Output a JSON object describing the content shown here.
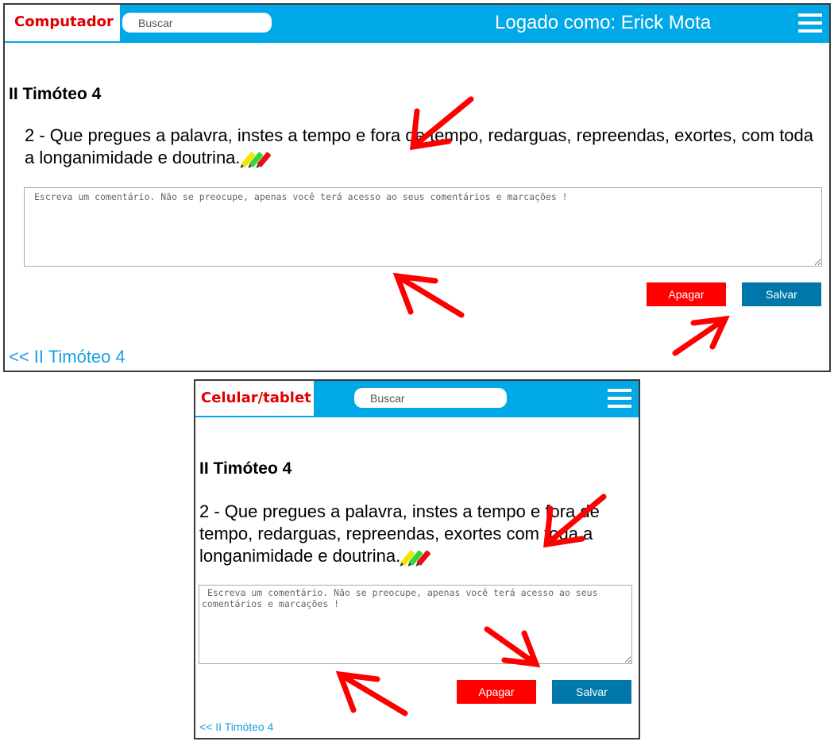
{
  "desktop": {
    "label": "Computador",
    "search_placeholder": "Buscar",
    "login_text": "Logado como: Erick Mota",
    "menu_icon": "hamburger-menu-icon",
    "title": "II Timóteo 4",
    "verse": "2 - Que pregues a palavra, instes a tempo e fora de tempo, redarguas, repreendas, exortes, com toda a longanimidade e doutrina.",
    "comment_placeholder": "Escreva um comentário. Não se preocupe, apenas você terá acesso ao seus comentários e marcações !",
    "delete_label": "Apagar",
    "save_label": "Salvar",
    "back_link": "<< II Timóteo 4"
  },
  "mobile": {
    "label": "Celular/tablet",
    "search_placeholder": "Buscar",
    "menu_icon": "hamburger-menu-icon",
    "title": "II Timóteo 4",
    "verse": "2 - Que pregues a palavra, instes a tempo e fora de tempo, redarguas, repreendas, exortes com toda a longanimidade e doutrina.",
    "comment_placeholder": " Escreva um comentário. Não se preocupe, apenas você terá acesso ao seus comentários e marcações !",
    "delete_label": "Apagar",
    "save_label": "Salvar",
    "back_link": "<< II Timóteo 4"
  },
  "highlighter_colors": [
    "#f2e600",
    "#33d633",
    "#e81010"
  ],
  "colors": {
    "header": "#00a8e8",
    "label_text": "#e00000",
    "delete_button": "#ff0000",
    "save_button": "#0077aa",
    "link": "#1aa0e0",
    "annotation_arrow": "#ff0000"
  }
}
